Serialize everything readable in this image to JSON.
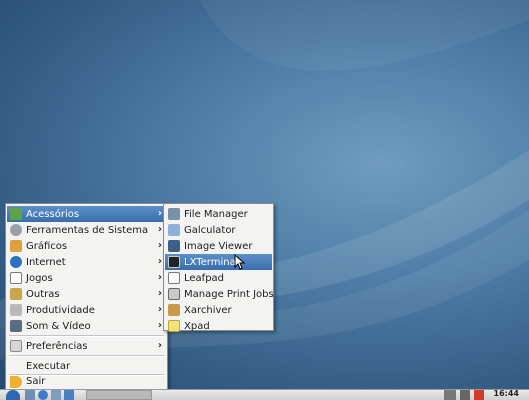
{
  "main_menu": {
    "items": [
      {
        "label": "Acessórios",
        "icon": "accessories-icon",
        "submenu": true,
        "highlighted": true
      },
      {
        "label": "Ferramentas de Sistema",
        "icon": "system-tools-icon",
        "submenu": true
      },
      {
        "label": "Gráficos",
        "icon": "graphics-icon",
        "submenu": true
      },
      {
        "label": "Internet",
        "icon": "internet-icon",
        "submenu": true
      },
      {
        "label": "Jogos",
        "icon": "games-icon",
        "submenu": true
      },
      {
        "label": "Outras",
        "icon": "other-icon",
        "submenu": true
      },
      {
        "label": "Produtividade",
        "icon": "office-icon",
        "submenu": true
      },
      {
        "label": "Som & Vídeo",
        "icon": "multimedia-icon",
        "submenu": true
      }
    ],
    "preferences": "Preferências",
    "run": "Executar",
    "logout": "Sair"
  },
  "sub_menu": {
    "items": [
      {
        "label": "File Manager",
        "icon": "file-manager-icon"
      },
      {
        "label": "Galculator",
        "icon": "calculator-icon"
      },
      {
        "label": "Image Viewer",
        "icon": "image-viewer-icon"
      },
      {
        "label": "LXTerminal",
        "icon": "terminal-icon",
        "highlighted": true
      },
      {
        "label": "Leafpad",
        "icon": "text-editor-icon"
      },
      {
        "label": "Manage Print Jobs",
        "icon": "printer-icon"
      },
      {
        "label": "Xarchiver",
        "icon": "archive-icon"
      },
      {
        "label": "Xpad",
        "icon": "notes-icon"
      }
    ]
  },
  "taskbar": {
    "clock": "16:44"
  },
  "colors": {
    "highlight": "#3a6eab",
    "desktop": "#4f7fa8",
    "menu_bg": "#f3f3f1"
  }
}
